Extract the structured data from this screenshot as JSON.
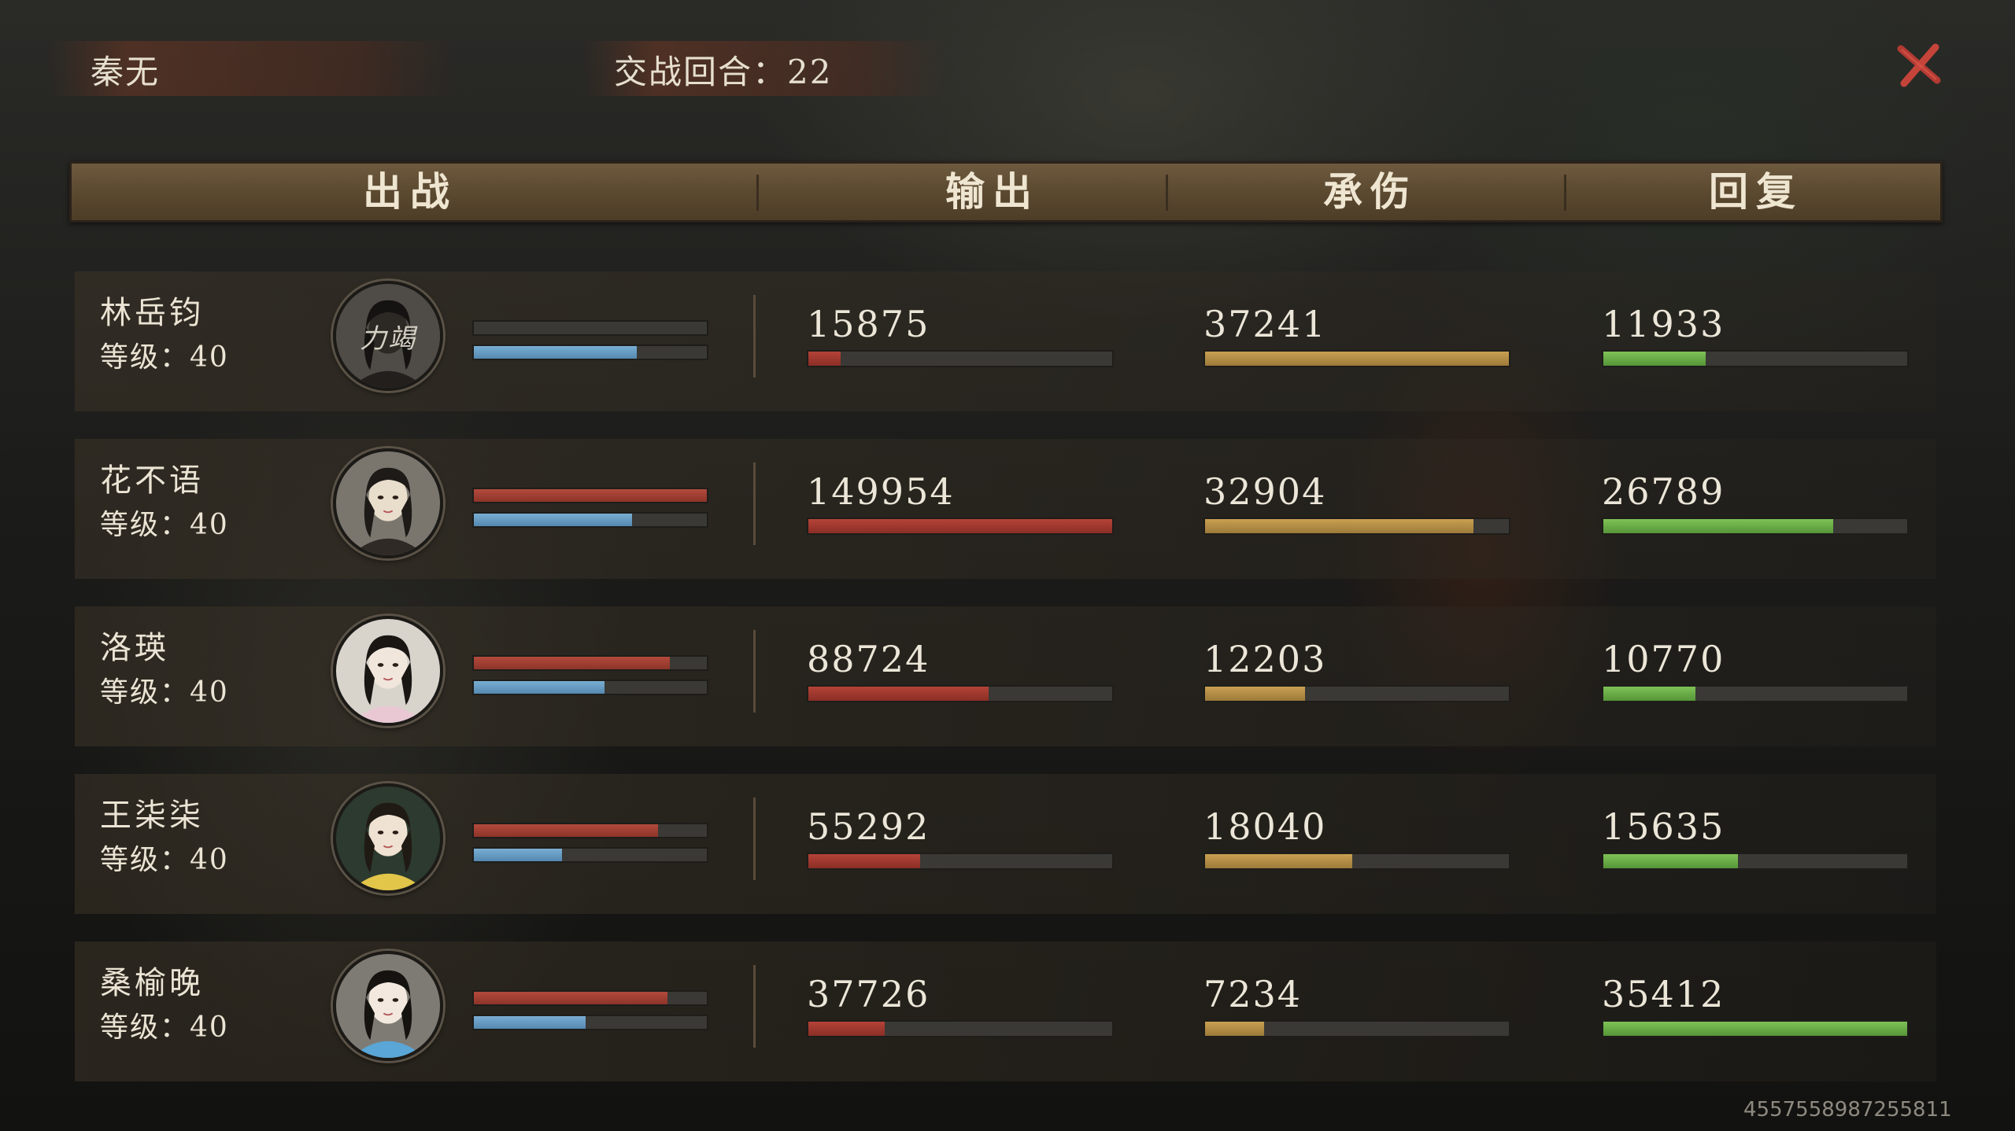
{
  "player_name": "秦无",
  "round_label": "交战回合：22",
  "headers": [
    "出战",
    "输出",
    "承伤",
    "回复"
  ],
  "colors": {
    "damage": "#b54338",
    "tank": "#c9a052",
    "heal": "#7fc257",
    "hp": "#b24a3c",
    "mp": "#79aed3"
  },
  "characters": [
    {
      "name": "林岳钧",
      "level": "等级：40",
      "avatar_text": "力竭",
      "hp": 0.0,
      "mp": 0.7,
      "damage": "15875",
      "damage_ratio": 0.106,
      "taken": "37241",
      "taken_ratio": 1.0,
      "heal": "11933",
      "heal_ratio": 0.337
    },
    {
      "name": "花不语",
      "level": "等级：40",
      "avatar_text": "",
      "hp": 1.0,
      "mp": 0.68,
      "damage": "149954",
      "damage_ratio": 1.0,
      "taken": "32904",
      "taken_ratio": 0.884,
      "heal": "26789",
      "heal_ratio": 0.757
    },
    {
      "name": "洛瑛",
      "level": "等级：40",
      "avatar_text": "",
      "hp": 0.84,
      "mp": 0.56,
      "damage": "88724",
      "damage_ratio": 0.592,
      "taken": "12203",
      "taken_ratio": 0.328,
      "heal": "10770",
      "heal_ratio": 0.304
    },
    {
      "name": "王柒柒",
      "level": "等级：40",
      "avatar_text": "",
      "hp": 0.79,
      "mp": 0.38,
      "damage": "55292",
      "damage_ratio": 0.369,
      "taken": "18040",
      "taken_ratio": 0.484,
      "heal": "15635",
      "heal_ratio": 0.442
    },
    {
      "name": "桑榆晚",
      "level": "等级：40",
      "avatar_text": "",
      "hp": 0.83,
      "mp": 0.48,
      "damage": "37726",
      "damage_ratio": 0.252,
      "taken": "7234",
      "taken_ratio": 0.194,
      "heal": "35412",
      "heal_ratio": 1.0
    }
  ],
  "uid": "4557558987255811"
}
